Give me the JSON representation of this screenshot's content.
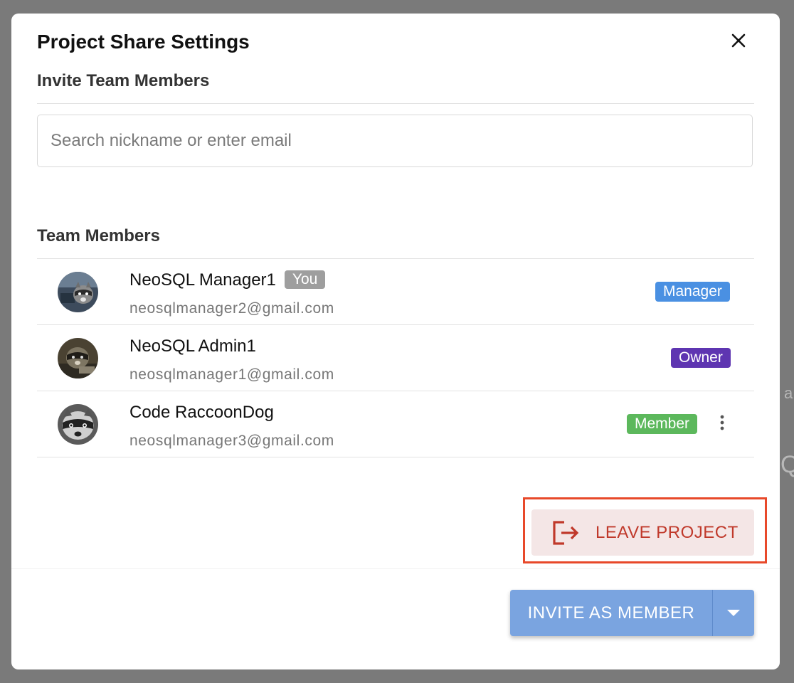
{
  "dialog": {
    "title": "Project Share Settings"
  },
  "invite": {
    "section_title": "Invite Team Members",
    "search_placeholder": "Search nickname or enter email"
  },
  "team": {
    "section_title": "Team Members",
    "members": [
      {
        "name": "NeoSQL Manager1",
        "you_badge": "You",
        "email": "neosqlmanager2@gmail.com",
        "role": "Manager",
        "role_color": "#4a90e2"
      },
      {
        "name": "NeoSQL Admin1",
        "email": "neosqlmanager1@gmail.com",
        "role": "Owner",
        "role_color": "#5e35b1"
      },
      {
        "name": "Code RaccoonDog",
        "email": "neosqlmanager3@gmail.com",
        "role": "Member",
        "role_color": "#5cb85c"
      }
    ]
  },
  "actions": {
    "leave_label": "LEAVE PROJECT",
    "invite_label": "INVITE AS MEMBER"
  },
  "icons": {
    "close": "close-icon",
    "leave": "logout-icon",
    "more": "more-vert-icon",
    "dropdown": "caret-down-icon"
  },
  "background": {
    "partial_text_1": "a",
    "partial_text_2": "Q"
  }
}
